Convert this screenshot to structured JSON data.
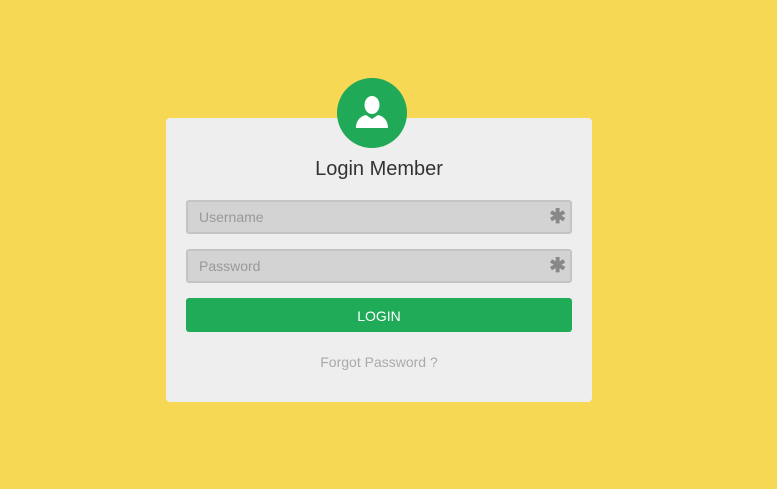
{
  "colors": {
    "background": "#f7d855",
    "card": "#eeeeee",
    "accent": "#20ab59",
    "field": "#d3d3d3"
  },
  "avatar": {
    "icon": "user-icon"
  },
  "form": {
    "title": "Login Member",
    "username": {
      "placeholder": "Username",
      "value": "",
      "required_marker": "✱"
    },
    "password": {
      "placeholder": "Password",
      "value": "",
      "required_marker": "✱"
    },
    "login_label": "LOGIN",
    "forgot_label": "Forgot Password ?"
  }
}
